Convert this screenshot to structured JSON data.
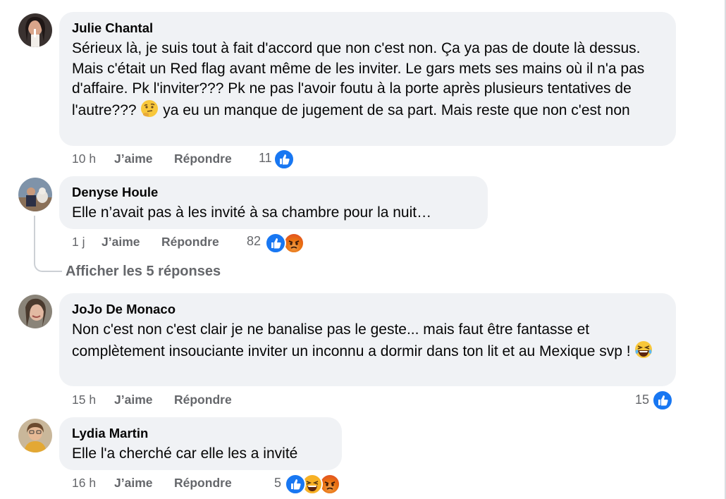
{
  "comments": [
    {
      "author": "Julie Chantal",
      "text": "Sérieux là, je suis tout à fait d'accord que non c'est non. Ça ya pas de doute là dessus. Mais c'était un Red flag avant même de les inviter. Le gars mets ses mains où il n'a pas d'affaire. Pk l'inviter??? Pk ne pas l'avoir foutu à la porte après plusieurs tentatives de l'autre???",
      "text_after_emoji": "ya eu un manque de jugement de sa part. Mais reste que non c'est non",
      "emoji": "thinking-face",
      "time": "10 h",
      "like_label": "J’aime",
      "reply_label": "Répondre",
      "reaction_count": "11",
      "reactions": [
        "like"
      ]
    },
    {
      "author": "Denyse Houle",
      "text": "Elle n’avait pas à les invité à sa chambre pour la nuit…",
      "time": "1 j",
      "like_label": "J’aime",
      "reply_label": "Répondre",
      "reaction_count": "82",
      "reactions": [
        "like",
        "angry"
      ],
      "view_replies": "Afficher les 5 réponses"
    },
    {
      "author": "JoJo De Monaco",
      "text": "Non c'est non c'est clair je ne banalise pas le geste... mais faut être fantasse et complètement insouciante inviter un inconnu a dormir dans ton lit et au Mexique svp !",
      "emoji": "grinning-squinting-face",
      "time": "15 h",
      "like_label": "J’aime",
      "reply_label": "Répondre",
      "reaction_count": "15",
      "reactions": [
        "like"
      ]
    },
    {
      "author": "Lydia Martin",
      "text": "Elle l'a cherché car elle les a invité",
      "time": "16 h",
      "like_label": "J’aime",
      "reply_label": "Répondre",
      "reaction_count": "5",
      "reactions": [
        "like",
        "haha",
        "angry"
      ]
    }
  ],
  "colors": {
    "bubble": "#f0f2f5",
    "meta": "#65676b",
    "like": "#1877f2",
    "angry": "#e9710f"
  }
}
